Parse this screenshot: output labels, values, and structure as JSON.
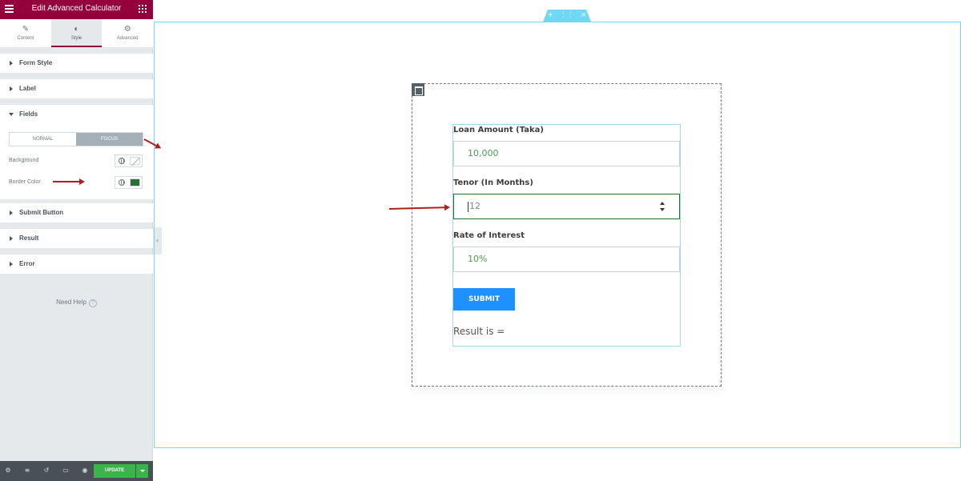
{
  "panel": {
    "title": "Edit Advanced Calculator",
    "tabs": [
      {
        "label": "Content",
        "icon": "pencil-icon"
      },
      {
        "label": "Style",
        "icon": "half-circle-icon"
      },
      {
        "label": "Advanced",
        "icon": "gear-icon"
      }
    ],
    "sections": {
      "form_style": "Form Style",
      "label": "Label",
      "fields": "Fields",
      "submit_button": "Submit Button",
      "result": "Result",
      "error": "Error"
    },
    "fields": {
      "normal": "NORMAL",
      "focus": "FOCUS",
      "background_label": "Background",
      "border_color_label": "Border Color",
      "border_color_value": "#2c6e38"
    },
    "help": "Need Help",
    "update": "UPDATE"
  },
  "calculator": {
    "loan_label": "Loan Amount (Taka)",
    "loan_value": "10,000",
    "tenor_label": "Tenor (In Months)",
    "tenor_value": "12",
    "rate_label": "Rate of Interest",
    "rate_value": "10%",
    "submit": "SUBMIT",
    "result": "Result is ="
  },
  "colors": {
    "brand": "#93003c",
    "canvas_outline": "#71d7f7",
    "submit_blue": "#1e90ff",
    "update_green": "#39b54a",
    "annotation_red": "#b01e1e"
  }
}
